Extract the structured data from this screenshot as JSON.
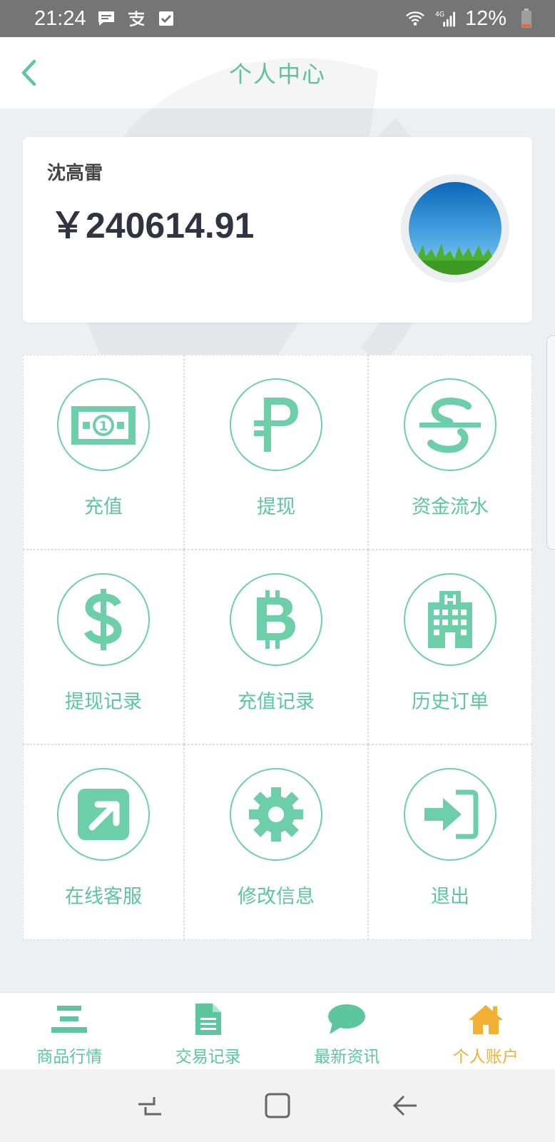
{
  "status_bar": {
    "time": "21:24",
    "battery": "12%",
    "icons": [
      "message-icon",
      "alipay-icon",
      "check-box-icon",
      "wifi-icon",
      "signal-4g-icon",
      "battery-icon"
    ]
  },
  "header": {
    "title": "个人中心",
    "back_icon": "chevron-left-icon"
  },
  "profile": {
    "name": "沈高雷",
    "balance": "￥240614.91"
  },
  "menu": [
    {
      "label": "充值",
      "icon": "banknote-icon"
    },
    {
      "label": "提现",
      "icon": "ruble-icon"
    },
    {
      "label": "资金流水",
      "icon": "strikethrough-s-icon"
    },
    {
      "label": "提现记录",
      "icon": "dollar-icon"
    },
    {
      "label": "充值记录",
      "icon": "bitcoin-icon"
    },
    {
      "label": "历史订单",
      "icon": "hospital-building-icon"
    },
    {
      "label": "在线客服",
      "icon": "external-link-square-icon"
    },
    {
      "label": "修改信息",
      "icon": "gear-icon"
    },
    {
      "label": "退出",
      "icon": "sign-in-icon"
    }
  ],
  "bottom_nav": [
    {
      "label": "商品行情",
      "icon": "bars-icon",
      "active": false
    },
    {
      "label": "交易记录",
      "icon": "document-icon",
      "active": false
    },
    {
      "label": "最新资讯",
      "icon": "chat-bubble-icon",
      "active": false
    },
    {
      "label": "个人账户",
      "icon": "home-icon",
      "active": true
    }
  ],
  "colors": {
    "accent": "#5cc69f",
    "active_tab": "#f2b132",
    "status_bar": "#757575",
    "background": "#eeeff3"
  }
}
